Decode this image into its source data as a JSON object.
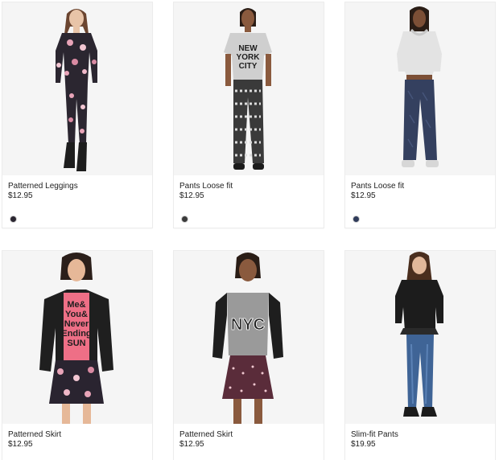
{
  "products": [
    {
      "name": "Patterned Leggings",
      "price": "$12.95",
      "swatch_color": "#2a2530",
      "image": "woman in floral print sweatshirt and leggings"
    },
    {
      "name": "Pants Loose fit",
      "price": "$12.95",
      "swatch_color": "#3a3a3a",
      "image": "woman in NEW YORK CITY tee and patterned pants"
    },
    {
      "name": "Pants Loose fit",
      "price": "$12.95",
      "swatch_color": "#2f3b5a",
      "image": "woman in grey hoodie and navy pants"
    },
    {
      "name": "Patterned Skirt",
      "price": "$12.95",
      "image": "woman in black hoodie and floral skirt"
    },
    {
      "name": "Patterned Skirt",
      "price": "$12.95",
      "image": "woman in NYC raglan tee and dotted skirt"
    },
    {
      "name": "Slim-fit Pants",
      "price": "$19.95",
      "image": "woman in black top and blue jeans"
    }
  ],
  "print_text": {
    "nyc_tee": [
      "NEW",
      "YORK",
      "CITY"
    ],
    "raglan": "NYC",
    "pink_tee": [
      "Me&",
      "You&",
      "Never",
      "Ending",
      "SUN"
    ]
  }
}
